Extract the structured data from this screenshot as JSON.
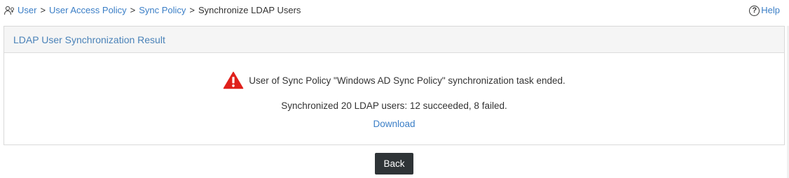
{
  "breadcrumb": {
    "icon": "user-policy-icon",
    "items": [
      {
        "label": "User",
        "link": true
      },
      {
        "label": "User Access Policy",
        "link": true
      },
      {
        "label": "Sync Policy",
        "link": true
      },
      {
        "label": "Synchronize LDAP Users",
        "link": false
      }
    ],
    "separator": ">"
  },
  "help": {
    "icon": "help-circle-icon",
    "icon_glyph": "?",
    "label": "Help"
  },
  "panel": {
    "title": "LDAP User Synchronization Result",
    "warning_icon": "warning-triangle-icon",
    "message": "User of Sync Policy \"Windows AD Sync Policy\" synchronization task ended.",
    "summary": "Synchronized 20 LDAP users: 12 succeeded, 8 failed.",
    "download_label": "Download"
  },
  "actions": {
    "back_label": "Back"
  },
  "colors": {
    "link": "#3a7ec6",
    "header_text": "#4a82b8",
    "warning_red": "#e0201b",
    "button_bg": "#2f3437"
  }
}
